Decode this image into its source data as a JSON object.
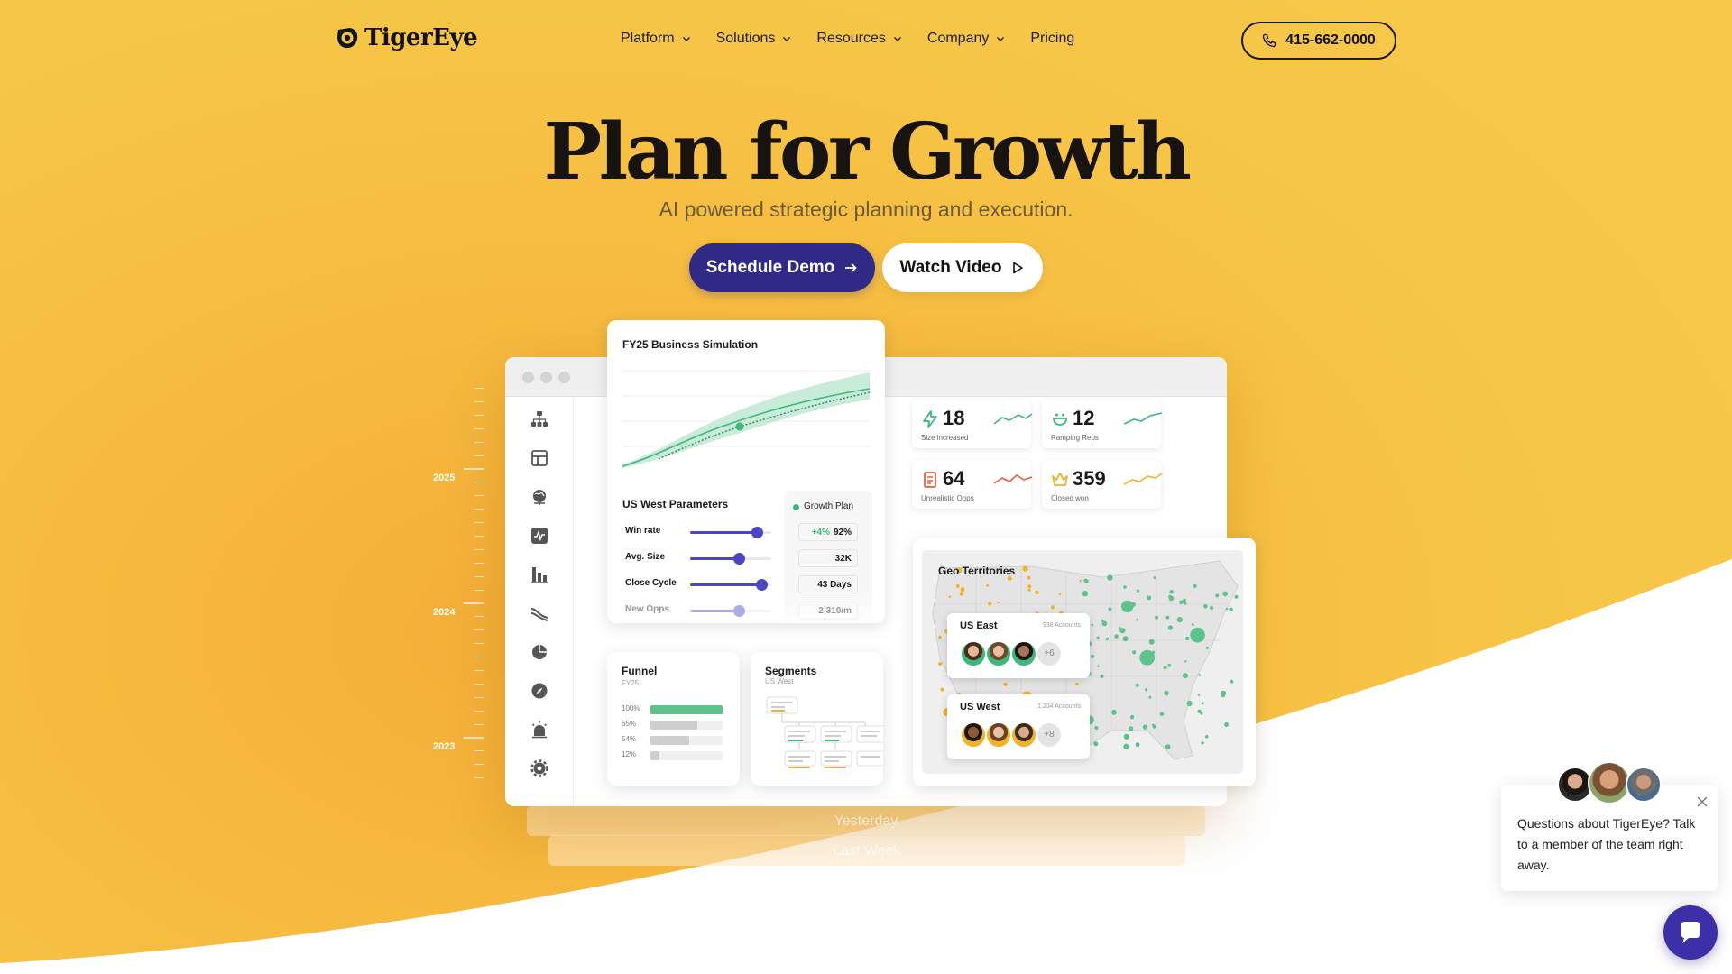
{
  "brand": {
    "name": "TigerEye"
  },
  "nav": {
    "items": [
      {
        "label": "Platform",
        "has_dropdown": true
      },
      {
        "label": "Solutions",
        "has_dropdown": true
      },
      {
        "label": "Resources",
        "has_dropdown": true
      },
      {
        "label": "Company",
        "has_dropdown": true
      },
      {
        "label": "Pricing",
        "has_dropdown": false
      }
    ],
    "phone": "415-662-0000"
  },
  "hero": {
    "title": "Plan for Growth",
    "subtitle": "AI powered strategic planning and execution.",
    "primary_cta": "Schedule Demo",
    "secondary_cta": "Watch Video"
  },
  "timeline": {
    "years": [
      "2025",
      "2024",
      "2023"
    ]
  },
  "history_cards": {
    "yesterday": "Yesterday",
    "last_week": "Last Week"
  },
  "dashboard": {
    "sidebar_icons": [
      "org-chart-icon",
      "table-icon",
      "globe-icon",
      "activity-icon",
      "bar-chart-icon",
      "trend-icon",
      "pie-chart-icon",
      "compass-icon",
      "alarm-icon",
      "settings-icon"
    ],
    "simulation": {
      "title": "FY25 Business Simulation"
    },
    "parameters": {
      "title": "US West Parameters",
      "legend": "Growth Plan",
      "rows": [
        {
          "label": "Win rate",
          "delta": "+4%",
          "value": "92%",
          "level": 0.82
        },
        {
          "label": "Avg. Size",
          "delta": "",
          "value": "32K",
          "level": 0.6
        },
        {
          "label": "Close Cycle",
          "delta": "",
          "value": "43 Days",
          "level": 0.88
        },
        {
          "label": "New Opps",
          "delta": "",
          "value": "2,310/m",
          "level": 0.6
        }
      ]
    },
    "stats": [
      {
        "number": "18",
        "label": "Size increased",
        "icon": "lightning-icon",
        "color": "#3cb878"
      },
      {
        "number": "12",
        "label": "Ramping Reps",
        "icon": "smile-icon",
        "color": "#3cb878"
      },
      {
        "number": "64",
        "label": "Unrealistic Opps",
        "icon": "document-icon",
        "color": "#e2603a"
      },
      {
        "number": "359",
        "label": "Closed won",
        "icon": "crown-icon",
        "color": "#f0b429"
      }
    ],
    "funnel": {
      "title": "Funnel",
      "subtitle": "FY25",
      "rows": [
        {
          "label": "100%",
          "level": 1.0
        },
        {
          "label": "65%",
          "level": 0.65
        },
        {
          "label": "54%",
          "level": 0.54
        },
        {
          "label": "12%",
          "level": 0.12
        }
      ]
    },
    "segments": {
      "title": "Segments",
      "subtitle": "US West"
    },
    "geo": {
      "title": "Geo Territories",
      "regions": [
        {
          "name": "US East",
          "accounts": "938 Accounts",
          "more": "+6"
        },
        {
          "name": "US West",
          "accounts": "1,234 Accounts",
          "more": "+8"
        }
      ]
    }
  },
  "chat": {
    "message": "Questions about TigerEye? Talk to a member of the team right away."
  },
  "colors": {
    "background": "#f7c546",
    "primary_button": "#2e2a86",
    "accent_green": "#3cb878",
    "slider": "#4a46c4"
  }
}
